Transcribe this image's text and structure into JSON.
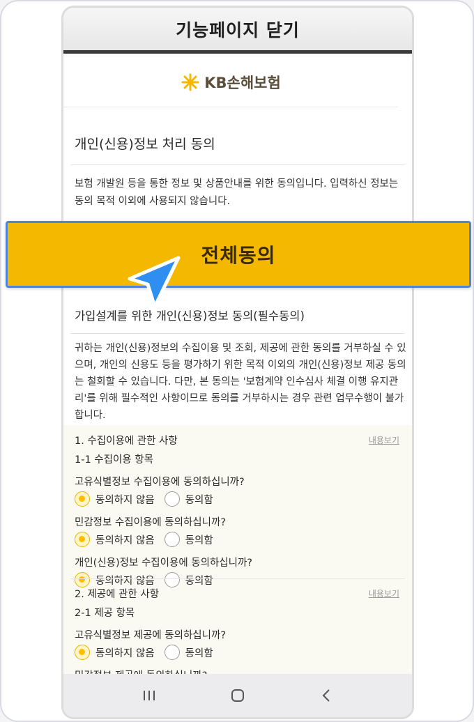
{
  "topbar": {
    "title": "기능페이지 닫기"
  },
  "brand": {
    "logo_text": "KB손해보험"
  },
  "section": {
    "title": "개인(신용)정보 처리 동의",
    "description": "보험 개발원 등을 통한 정보 및 상품안내를 위한 동의입니다. 입력하신 정보는 동의 목적 이외에 사용되지 않습니다."
  },
  "agree_all": {
    "label": "전체동의"
  },
  "subsection": {
    "title": "가입설계를 위한 개인(신용)정보 동의(필수동의)",
    "description": "귀하는 개인(신용)정보의 수집이용 및 조회, 제공에 관한 동의를 거부하실 수 있으며, 개인의 신용도 등을 평가하기 위한 목적 이외의 개인(신용)정보 제공 동의는 철회할 수 있습니다. 다만, 본 동의는 '보험계약 인수심사 체결 이행 유지관리'를 위해 필수적인 사항이므로 동의를 거부하시는 경우 관련 업무수행이 불가합니다."
  },
  "consents": [
    {
      "title": "1. 수집이용에 관한 사항",
      "view_link": "내용보기",
      "sub": "1-1 수집이용 항목",
      "questions": [
        {
          "text": "고유식별정보 수집이용에 동의하십니까?",
          "opt_no": "동의하지 않음",
          "opt_yes": "동의함",
          "selected": "no"
        },
        {
          "text": "민감정보 수집이용에 동의하십니까?",
          "opt_no": "동의하지 않음",
          "opt_yes": "동의함",
          "selected": "no"
        },
        {
          "text": "개인(신용)정보 수집이용에 동의하십니까?",
          "opt_no": "동의하지 않음",
          "opt_yes": "동의함",
          "selected": "no"
        }
      ]
    },
    {
      "title": "2. 제공에 관한 사항",
      "view_link": "내용보기",
      "sub": "2-1 제공 항목",
      "questions": [
        {
          "text": "고유식별정보 제공에 동의하십니까?",
          "opt_no": "동의하지 않음",
          "opt_yes": "동의함",
          "selected": "no"
        },
        {
          "text": "민감정보 제공에 동의하십니까?"
        }
      ]
    }
  ],
  "colors": {
    "accent": "#f5b800",
    "selection_border": "#4c86d9",
    "cursor": "#2f8ff0"
  },
  "icons": {
    "nav_recent": "recent-apps-icon",
    "nav_home": "home-icon",
    "nav_back": "back-icon",
    "pointer": "pointer-cursor-icon"
  }
}
